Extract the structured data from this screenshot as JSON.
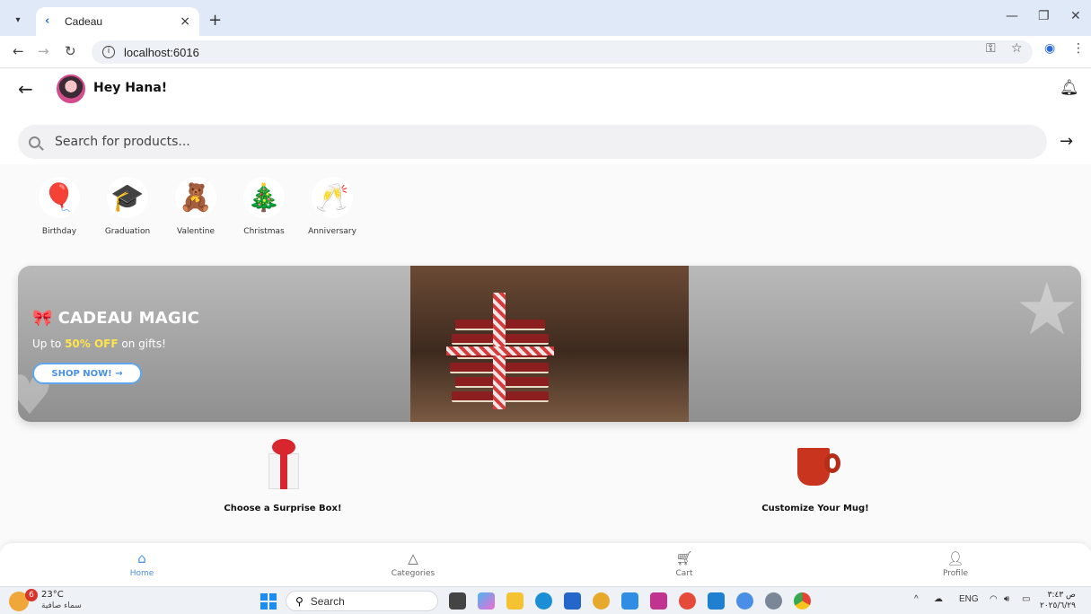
{
  "browser": {
    "tab_title": "Cadeau",
    "tab_close": "×",
    "new_tab": "+",
    "url": "localhost:6016",
    "window_minimize": "—",
    "window_restore": "❐",
    "window_close": "✕"
  },
  "header": {
    "greeting": "Hey Hana!"
  },
  "search": {
    "placeholder": "Search for products..."
  },
  "categories": [
    {
      "label": "Birthday",
      "icon": "balloons-icon"
    },
    {
      "label": "Graduation",
      "icon": "graduation-cap-icon"
    },
    {
      "label": "Valentine",
      "icon": "teddy-bear-icon"
    },
    {
      "label": "Christmas",
      "icon": "wreath-icon"
    },
    {
      "label": "Anniversary",
      "icon": "champagne-icon"
    }
  ],
  "banner": {
    "title": "CADEAU MAGIC",
    "sub_prefix": "Up to ",
    "sub_highlight": "50% OFF",
    "sub_suffix": " on gifts!",
    "cta": "SHOP NOW! →",
    "highlight_color": "#ffe44a"
  },
  "features": [
    {
      "label": "Choose a Surprise Box!",
      "icon": "gift-box-icon"
    },
    {
      "label": "Customize Your Mug!",
      "icon": "mug-icon"
    }
  ],
  "bottom_nav": [
    {
      "label": "Home",
      "icon": "home-icon",
      "active": true
    },
    {
      "label": "Categories",
      "icon": "categories-icon",
      "active": false
    },
    {
      "label": "Cart",
      "icon": "cart-icon",
      "active": false
    },
    {
      "label": "Profile",
      "icon": "profile-icon",
      "active": false
    }
  ],
  "taskbar": {
    "weather_badge": "6",
    "weather_temp": "23°C",
    "weather_desc": "سماء صافية",
    "search_label": "Search",
    "lang": "ENG",
    "time": "ص ٣:٤٣",
    "date": "٢٠٢٥/٦/٢٩"
  },
  "colors": {
    "accent": "#4a8fe6",
    "tab_bar": "#dfe9f7"
  }
}
